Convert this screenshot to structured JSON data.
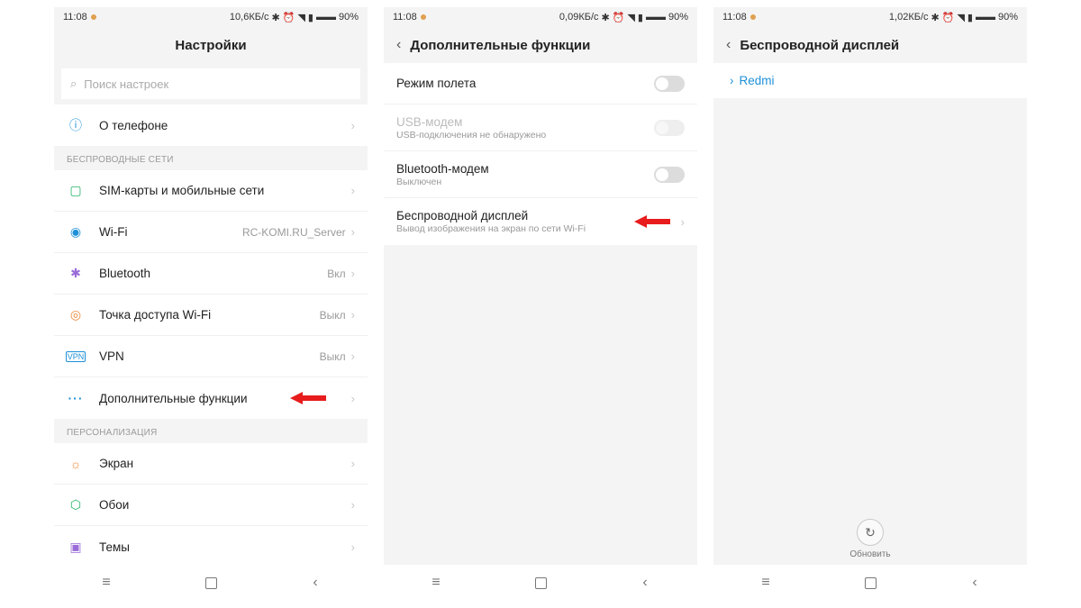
{
  "status": {
    "time": "11:08",
    "battery": "90%",
    "rates": [
      "10,6КБ/с",
      "0,09КБ/с",
      "1,02КБ/с"
    ]
  },
  "s1": {
    "title": "Настройки",
    "search_placeholder": "Поиск настроек",
    "about": "О телефоне",
    "section_wireless": "БЕСПРОВОДНЫЕ СЕТИ",
    "sim": "SIM-карты и мобильные сети",
    "wifi": "Wi-Fi",
    "wifi_value": "RC-KOMI.RU_Server",
    "bluetooth": "Bluetooth",
    "bluetooth_value": "Вкл",
    "hotspot": "Точка доступа Wi-Fi",
    "hotspot_value": "Выкл",
    "vpn": "VPN",
    "vpn_value": "Выкл",
    "more": "Дополнительные функции",
    "section_personal": "ПЕРСОНАЛИЗАЦИЯ",
    "screen": "Экран",
    "wallpaper": "Обои",
    "themes": "Темы"
  },
  "s2": {
    "title": "Дополнительные функции",
    "airplane": "Режим полета",
    "usb": "USB-модем",
    "usb_sub": "USB-подключения не обнаружено",
    "bt_tether": "Bluetooth-модем",
    "bt_tether_sub": "Выключен",
    "wdisplay": "Беспроводной дисплей",
    "wdisplay_sub": "Вывод изображения на экран по сети Wi-Fi"
  },
  "s3": {
    "title": "Беспроводной дисплей",
    "device": "Redmi",
    "refresh": "Обновить"
  }
}
